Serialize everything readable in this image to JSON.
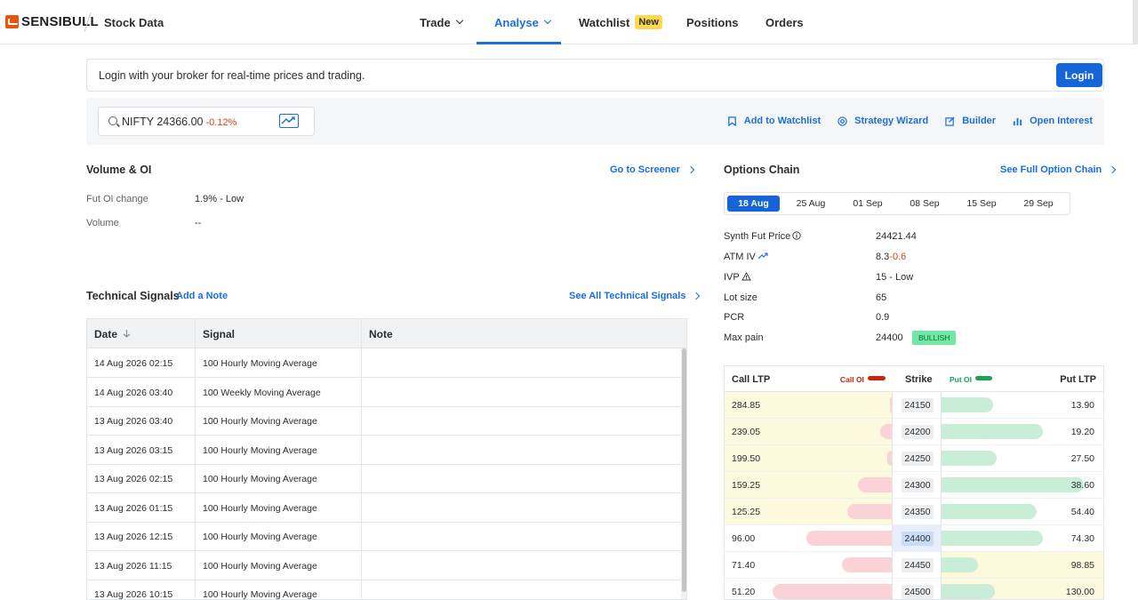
{
  "app": {
    "brand": "SENSIBULL",
    "page": "Stock Data"
  },
  "nav": {
    "trade": "Trade",
    "analyse": "Analyse",
    "watchlist": "Watchlist",
    "new_badge": "New",
    "positions": "Positions",
    "orders": "Orders"
  },
  "login_bar": {
    "message": "Login with your broker for real-time prices and trading.",
    "button": "Login"
  },
  "search": {
    "symbol": "NIFTY 24366.00",
    "change": "-0.12%"
  },
  "actions": {
    "watchlist": "Add to Watchlist",
    "wizard": "Strategy Wizard",
    "builder": "Builder",
    "oi": "Open Interest"
  },
  "volume_oi": {
    "title": "Volume & OI",
    "screener_link": "Go to Screener",
    "rows": [
      {
        "label": "Fut OI change",
        "value": "1.9% - Low"
      },
      {
        "label": "Volume",
        "value": "--"
      }
    ]
  },
  "signals": {
    "title": "Technical Signals",
    "add_note": "Add a Note",
    "see_all": "See All Technical Signals",
    "columns": [
      "Date",
      "Signal",
      "Note"
    ],
    "rows": [
      {
        "date": "14 Aug 2026 02:15",
        "signal": "100 Hourly Moving Average",
        "note": ""
      },
      {
        "date": "14 Aug 2026 03:40",
        "signal": "100 Weekly Moving Average",
        "note": ""
      },
      {
        "date": "13 Aug 2026 03:40",
        "signal": "100 Hourly Moving Average",
        "note": ""
      },
      {
        "date": "13 Aug 2026 03:15",
        "signal": "100 Hourly Moving Average",
        "note": ""
      },
      {
        "date": "13 Aug 2026 02:15",
        "signal": "100 Hourly Moving Average",
        "note": ""
      },
      {
        "date": "13 Aug 2026 01:15",
        "signal": "100 Hourly Moving Average",
        "note": ""
      },
      {
        "date": "13 Aug 2026 12:15",
        "signal": "100 Hourly Moving Average",
        "note": ""
      },
      {
        "date": "13 Aug 2026 11:15",
        "signal": "100 Hourly Moving Average",
        "note": ""
      },
      {
        "date": "13 Aug 2026 10:15",
        "signal": "100 Hourly Moving Average",
        "note": ""
      }
    ]
  },
  "option_chain": {
    "title": "Options Chain",
    "full_link": "See Full Option Chain",
    "expiries": [
      "18 Aug",
      "25 Aug",
      "01 Sep",
      "08 Sep",
      "15 Sep",
      "29 Sep"
    ],
    "selected_expiry": "18 Aug",
    "stats": [
      {
        "label": "Synth Fut Price",
        "value": "24421.44"
      },
      {
        "label": "ATM IV",
        "value": "8.3",
        "delta": "-0.6"
      },
      {
        "label": "IVP",
        "value": "15 - Low"
      },
      {
        "label": "Lot size",
        "value": "65"
      },
      {
        "label": "PCR",
        "value": "0.9"
      },
      {
        "label": "Max pain",
        "value": "24400",
        "badge": "BULLISH"
      }
    ],
    "headers": {
      "call_ltp": "Call LTP",
      "call_oi": "Call OI",
      "strike": "Strike",
      "put_oi": "Put OI",
      "put_ltp": "Put LTP"
    },
    "rows": [
      {
        "call_ltp": "284.85",
        "strike": "24150",
        "put_ltp": "13.90",
        "call_oi": 0.01,
        "put_oi": 0.34,
        "call_itm": true,
        "put_itm": false
      },
      {
        "call_ltp": "239.05",
        "strike": "24200",
        "put_ltp": "19.20",
        "call_oi": 0.1,
        "put_oi": 0.66,
        "call_itm": true,
        "put_itm": false
      },
      {
        "call_ltp": "199.50",
        "strike": "24250",
        "put_ltp": "27.50",
        "call_oi": 0.04,
        "put_oi": 0.36,
        "call_itm": true,
        "put_itm": false
      },
      {
        "call_ltp": "159.25",
        "strike": "24300",
        "put_ltp": "38.60",
        "call_oi": 0.28,
        "put_oi": 0.93,
        "call_itm": true,
        "put_itm": false
      },
      {
        "call_ltp": "125.25",
        "strike": "24350",
        "put_ltp": "54.40",
        "call_oi": 0.37,
        "put_oi": 0.62,
        "call_itm": true,
        "put_itm": false
      },
      {
        "call_ltp": "96.00",
        "strike": "24400",
        "put_ltp": "74.30",
        "call_oi": 0.72,
        "put_oi": 0.66,
        "call_itm": false,
        "put_itm": false,
        "atm": true
      },
      {
        "call_ltp": "71.40",
        "strike": "24450",
        "put_ltp": "98.85",
        "call_oi": 0.42,
        "put_oi": 0.24,
        "call_itm": false,
        "put_itm": true
      },
      {
        "call_ltp": "51.20",
        "strike": "24500",
        "put_ltp": "130.00",
        "call_oi": 1.0,
        "put_oi": 0.35,
        "call_itm": false,
        "put_itm": true
      }
    ]
  },
  "colors": {
    "accent": "#1565d8",
    "negative": "#d6451c",
    "itm": "#fdf9dc",
    "call_oi": "#c7270e",
    "put_oi": "#19a35b"
  }
}
